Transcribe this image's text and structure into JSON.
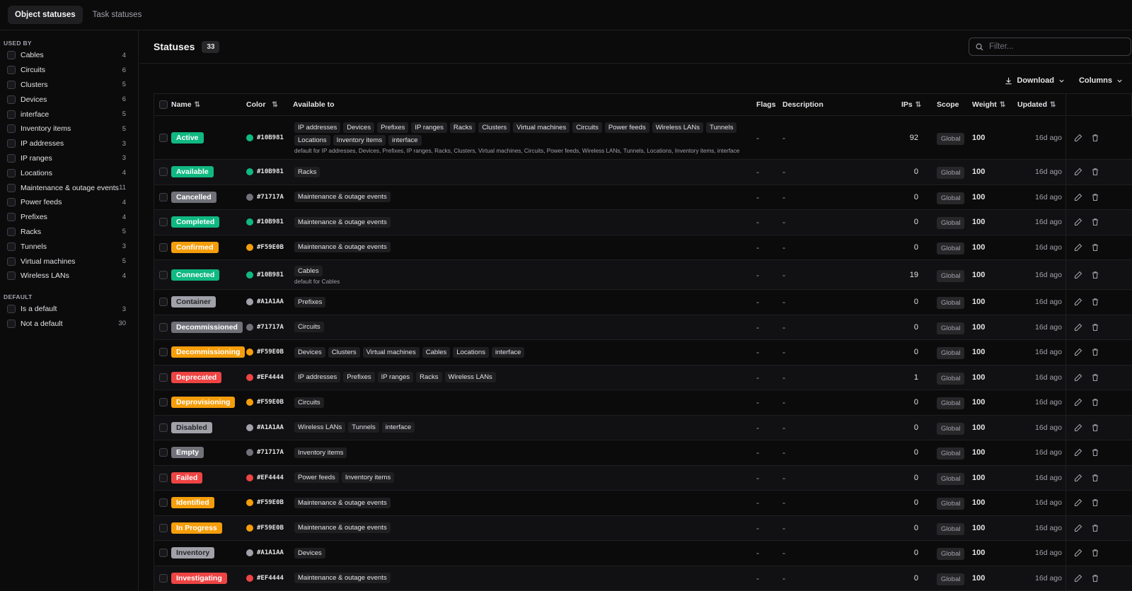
{
  "tabs": [
    "Object statuses",
    "Task statuses"
  ],
  "sidebar": {
    "used_by_title": "USED BY",
    "used_by": [
      {
        "label": "Cables",
        "count": "4"
      },
      {
        "label": "Circuits",
        "count": "6"
      },
      {
        "label": "Clusters",
        "count": "5"
      },
      {
        "label": "Devices",
        "count": "6"
      },
      {
        "label": "interface",
        "count": "5"
      },
      {
        "label": "Inventory items",
        "count": "5"
      },
      {
        "label": "IP addresses",
        "count": "3"
      },
      {
        "label": "IP ranges",
        "count": "3"
      },
      {
        "label": "Locations",
        "count": "4"
      },
      {
        "label": "Maintenance & outage events",
        "count": "11"
      },
      {
        "label": "Power feeds",
        "count": "4"
      },
      {
        "label": "Prefixes",
        "count": "4"
      },
      {
        "label": "Racks",
        "count": "5"
      },
      {
        "label": "Tunnels",
        "count": "3"
      },
      {
        "label": "Virtual machines",
        "count": "5"
      },
      {
        "label": "Wireless LANs",
        "count": "4"
      }
    ],
    "default_title": "DEFAULT",
    "default": [
      {
        "label": "Is a default",
        "count": "3"
      },
      {
        "label": "Not a default",
        "count": "30"
      }
    ]
  },
  "main": {
    "title": "Statuses",
    "count": "33",
    "filter_placeholder": "Filter...",
    "download_label": "Download",
    "columns_label": "Columns"
  },
  "columns": {
    "name": "Name",
    "color": "Color",
    "available_to": "Available to",
    "flags": "Flags",
    "description": "Description",
    "ips": "IPs",
    "scope": "Scope",
    "weight": "Weight",
    "updated": "Updated"
  },
  "rows": [
    {
      "name": "Active",
      "color": "#10B981",
      "available": [
        "IP addresses",
        "Devices",
        "Prefixes",
        "IP ranges",
        "Racks",
        "Clusters",
        "Virtual machines",
        "Circuits",
        "Power feeds",
        "Wireless LANs",
        "Tunnels",
        "Locations",
        "Inventory items",
        "interface"
      ],
      "sub": "default for IP addresses, Devices, Prefixes, IP ranges, Racks, Clusters, Virtual machines, Circuits, Power feeds, Wireless LANs, Tunnels, Locations, Inventory items, interface",
      "flags": "-",
      "desc": "-",
      "ips": "92",
      "scope": "Global",
      "weight": "100",
      "updated": "16d ago"
    },
    {
      "name": "Available",
      "color": "#10B981",
      "available": [
        "Racks"
      ],
      "sub": "",
      "flags": "-",
      "desc": "-",
      "ips": "0",
      "scope": "Global",
      "weight": "100",
      "updated": "16d ago"
    },
    {
      "name": "Cancelled",
      "color": "#71717A",
      "available": [
        "Maintenance & outage events"
      ],
      "sub": "",
      "flags": "-",
      "desc": "-",
      "ips": "0",
      "scope": "Global",
      "weight": "100",
      "updated": "16d ago"
    },
    {
      "name": "Completed",
      "color": "#10B981",
      "available": [
        "Maintenance & outage events"
      ],
      "sub": "",
      "flags": "-",
      "desc": "-",
      "ips": "0",
      "scope": "Global",
      "weight": "100",
      "updated": "16d ago"
    },
    {
      "name": "Confirmed",
      "color": "#F59E0B",
      "available": [
        "Maintenance & outage events"
      ],
      "sub": "",
      "flags": "-",
      "desc": "-",
      "ips": "0",
      "scope": "Global",
      "weight": "100",
      "updated": "16d ago"
    },
    {
      "name": "Connected",
      "color": "#10B981",
      "available": [
        "Cables"
      ],
      "sub": "default for Cables",
      "flags": "-",
      "desc": "-",
      "ips": "19",
      "scope": "Global",
      "weight": "100",
      "updated": "16d ago"
    },
    {
      "name": "Container",
      "color": "#A1A1AA",
      "available": [
        "Prefixes"
      ],
      "sub": "",
      "flags": "-",
      "desc": "-",
      "ips": "0",
      "scope": "Global",
      "weight": "100",
      "updated": "16d ago"
    },
    {
      "name": "Decommissioned",
      "color": "#71717A",
      "available": [
        "Circuits"
      ],
      "sub": "",
      "flags": "-",
      "desc": "-",
      "ips": "0",
      "scope": "Global",
      "weight": "100",
      "updated": "16d ago"
    },
    {
      "name": "Decommissioning",
      "color": "#F59E0B",
      "available": [
        "Devices",
        "Clusters",
        "Virtual machines",
        "Cables",
        "Locations",
        "interface"
      ],
      "sub": "",
      "flags": "-",
      "desc": "-",
      "ips": "0",
      "scope": "Global",
      "weight": "100",
      "updated": "16d ago"
    },
    {
      "name": "Deprecated",
      "color": "#EF4444",
      "available": [
        "IP addresses",
        "Prefixes",
        "IP ranges",
        "Racks",
        "Wireless LANs"
      ],
      "sub": "",
      "flags": "-",
      "desc": "-",
      "ips": "1",
      "scope": "Global",
      "weight": "100",
      "updated": "16d ago"
    },
    {
      "name": "Deprovisioning",
      "color": "#F59E0B",
      "available": [
        "Circuits"
      ],
      "sub": "",
      "flags": "-",
      "desc": "-",
      "ips": "0",
      "scope": "Global",
      "weight": "100",
      "updated": "16d ago"
    },
    {
      "name": "Disabled",
      "color": "#A1A1AA",
      "available": [
        "Wireless LANs",
        "Tunnels",
        "interface"
      ],
      "sub": "",
      "flags": "-",
      "desc": "-",
      "ips": "0",
      "scope": "Global",
      "weight": "100",
      "updated": "16d ago"
    },
    {
      "name": "Empty",
      "color": "#71717A",
      "available": [
        "Inventory items"
      ],
      "sub": "",
      "flags": "-",
      "desc": "-",
      "ips": "0",
      "scope": "Global",
      "weight": "100",
      "updated": "16d ago"
    },
    {
      "name": "Failed",
      "color": "#EF4444",
      "available": [
        "Power feeds",
        "Inventory items"
      ],
      "sub": "",
      "flags": "-",
      "desc": "-",
      "ips": "0",
      "scope": "Global",
      "weight": "100",
      "updated": "16d ago"
    },
    {
      "name": "Identified",
      "color": "#F59E0B",
      "available": [
        "Maintenance & outage events"
      ],
      "sub": "",
      "flags": "-",
      "desc": "-",
      "ips": "0",
      "scope": "Global",
      "weight": "100",
      "updated": "16d ago"
    },
    {
      "name": "In Progress",
      "color": "#F59E0B",
      "available": [
        "Maintenance & outage events"
      ],
      "sub": "",
      "flags": "-",
      "desc": "-",
      "ips": "0",
      "scope": "Global",
      "weight": "100",
      "updated": "16d ago"
    },
    {
      "name": "Inventory",
      "color": "#A1A1AA",
      "available": [
        "Devices"
      ],
      "sub": "",
      "flags": "-",
      "desc": "-",
      "ips": "0",
      "scope": "Global",
      "weight": "100",
      "updated": "16d ago"
    },
    {
      "name": "Investigating",
      "color": "#EF4444",
      "available": [
        "Maintenance & outage events"
      ],
      "sub": "",
      "flags": "-",
      "desc": "-",
      "ips": "0",
      "scope": "Global",
      "weight": "100",
      "updated": "16d ago"
    }
  ]
}
